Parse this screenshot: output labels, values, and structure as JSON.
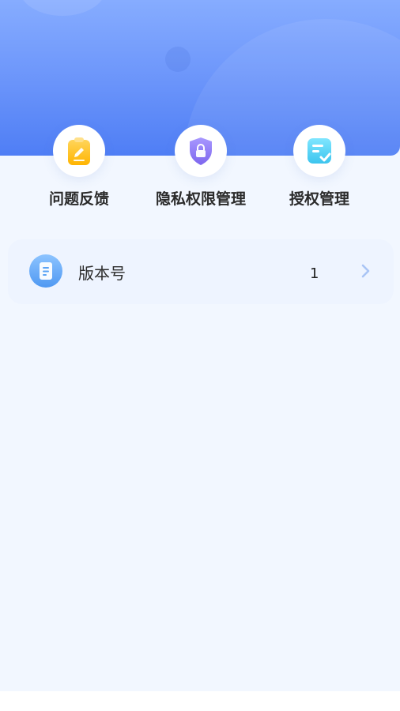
{
  "quick_actions": [
    {
      "label": "问题反馈",
      "icon": "clipboard-edit-icon"
    },
    {
      "label": "隐私权限管理",
      "icon": "shield-lock-icon"
    },
    {
      "label": "授权管理",
      "icon": "checklist-icon"
    }
  ],
  "settings": {
    "items": [
      {
        "label": "版本号",
        "value": "1",
        "icon": "document-icon",
        "chevron": "chevron-right-icon"
      }
    ]
  },
  "colors": {
    "header_gradient_top": "#86acff",
    "header_gradient_bottom": "#4f7ef5",
    "page_background": "#f2f7ff",
    "feedback_icon": "#ffc52e",
    "privacy_icon": "#8e7af5",
    "auth_icon": "#5ed6f3",
    "version_icon": "#5aa3f5"
  }
}
